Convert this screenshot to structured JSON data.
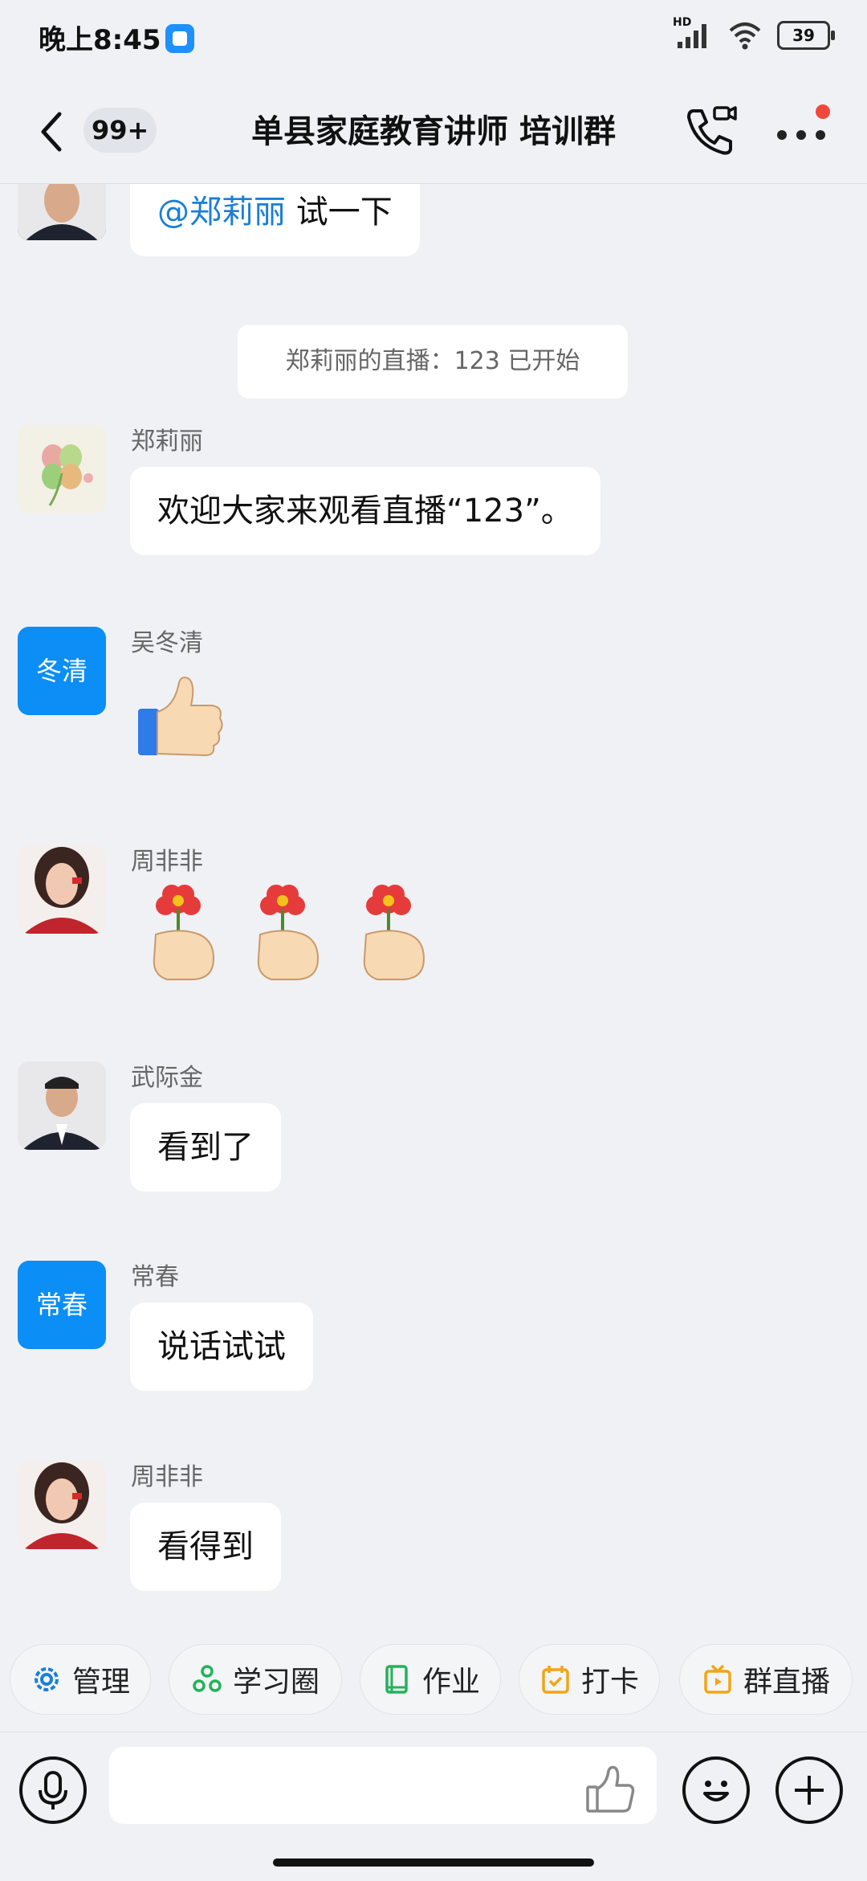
{
  "status_bar": {
    "time": "晚上8:45",
    "network": "HD",
    "battery": "39"
  },
  "header": {
    "back_icon": "chevron-left-icon",
    "unread_badge": "99+",
    "title": "单县家庭教育讲师 培训群",
    "call_icon": "video-call-icon",
    "more_icon": "more-dots-icon"
  },
  "messages": {
    "m0": {
      "mention": "@郑莉丽",
      "text": "试一下"
    },
    "system": "郑莉丽的直播：123 已开始",
    "m1": {
      "sender": "郑莉丽",
      "text": "欢迎大家来观看直播“123”。"
    },
    "m2": {
      "sender": "吴冬清",
      "avatar_text": "冬清",
      "emoji": "thumbs-up-sticker"
    },
    "m3": {
      "sender": "周非非",
      "emoji": "flower-hand-sticker"
    },
    "m4": {
      "sender": "武际金",
      "text": "看到了"
    },
    "m5": {
      "sender": "常春",
      "avatar_text": "常春",
      "text": "说话试试"
    },
    "m6": {
      "sender": "周非非",
      "text": "看得到"
    }
  },
  "quick_actions": [
    {
      "label": "管理",
      "icon": "gear-icon",
      "color": "#1a7fd6"
    },
    {
      "label": "学习圈",
      "icon": "learning-circle-icon",
      "color": "#22b35a"
    },
    {
      "label": "作业",
      "icon": "book-icon",
      "color": "#22b35a"
    },
    {
      "label": "打卡",
      "icon": "checkin-calendar-icon",
      "color": "#f2a516"
    },
    {
      "label": "群直播",
      "icon": "live-tv-icon",
      "color": "#f2a516"
    }
  ],
  "input_bar": {
    "voice_icon": "microphone-icon",
    "placeholder": "",
    "like_icon": "thumbs-up-icon",
    "emoji_icon": "smiley-icon",
    "add_icon": "plus-icon"
  },
  "colors": {
    "background": "#eff1f4",
    "accent": "#0b8ef5",
    "mention": "#1a7fd6",
    "badge_red": "#f0483d"
  }
}
